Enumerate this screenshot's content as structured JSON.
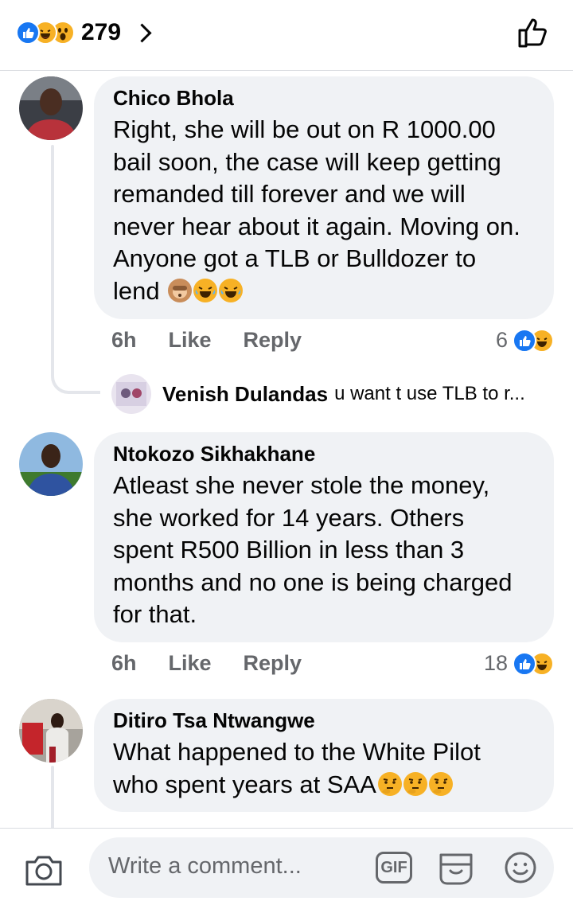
{
  "header": {
    "reaction_count": "279",
    "reaction_icons": [
      "like-icon",
      "haha-icon",
      "wow-icon"
    ],
    "like_icon": "thumbs-up-outline-icon"
  },
  "comments": [
    {
      "author": "Chico Bhola",
      "lines": [
        "Right, she will be out on R 1000.00",
        "bail soon, the case will keep getting",
        "remanded till forever and we will",
        "never hear about it again. Moving on.",
        "Anyone got a TLB or Bulldozer to",
        "lend"
      ],
      "trailing_emojis": [
        "see-no-evil-monkey-emoji",
        "tears-of-joy-emoji",
        "tears-of-joy-emoji"
      ],
      "time": "6h",
      "like_label": "Like",
      "reply_label": "Reply",
      "reaction_count": "6",
      "reply_preview": {
        "author": "Venish Dulandas",
        "snippet": "u want t use TLB to r..."
      }
    },
    {
      "author": "Ntokozo Sikhakhane",
      "lines": [
        "Atleast she never stole the money,",
        "she worked for 14 years. Others",
        "spent R500 Billion in less than 3",
        "months and no one is being charged",
        "for that."
      ],
      "time": "6h",
      "like_label": "Like",
      "reply_label": "Reply",
      "reaction_count": "18"
    },
    {
      "author": "Ditiro Tsa Ntwangwe",
      "lines": [
        "What happened to the White Pilot",
        "who spent years at SAA"
      ],
      "trailing_emojis": [
        "thinking-face-emoji",
        "thinking-face-emoji",
        "thinking-face-emoji"
      ]
    }
  ],
  "composer": {
    "placeholder": "Write a comment...",
    "gif_label": "GIF",
    "icons": [
      "camera-icon",
      "gif-icon",
      "sticker-icon",
      "emoji-icon"
    ]
  },
  "colors": {
    "facebook_blue": "#1877f2",
    "bubble_bg": "#f0f2f5",
    "secondary_text": "#65676b",
    "emoji_yellow": "#f7b125"
  }
}
